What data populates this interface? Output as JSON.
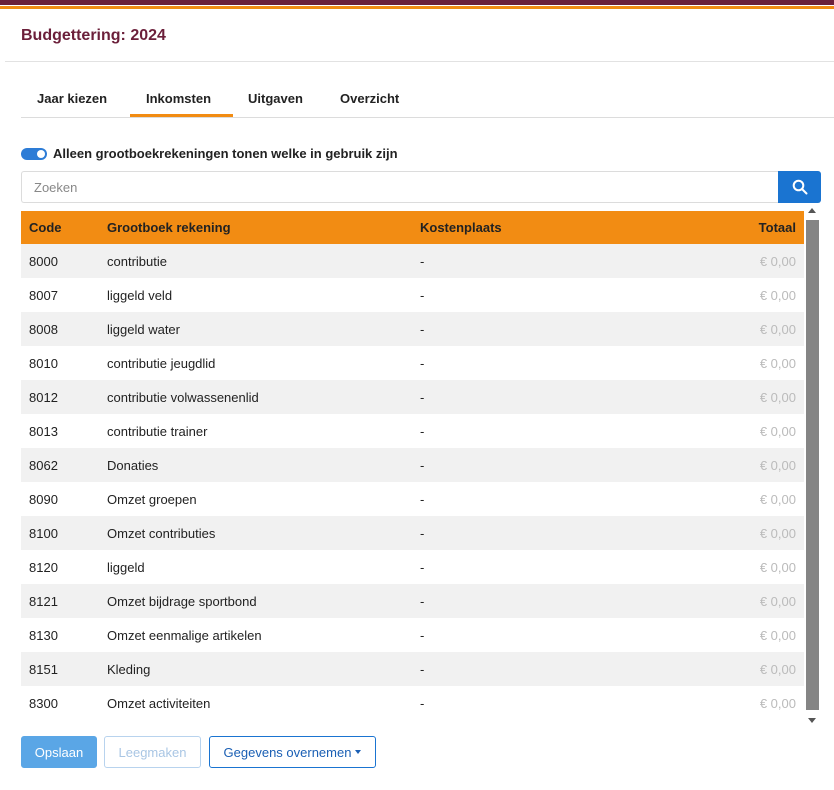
{
  "colors": {
    "brand_dark": "#6b1f3a",
    "accent": "#f28c13",
    "primary": "#1a74d1"
  },
  "header": {
    "title": "Budgettering: 2024"
  },
  "tabs": [
    {
      "label": "Jaar kiezen",
      "active": false
    },
    {
      "label": "Inkomsten",
      "active": true
    },
    {
      "label": "Uitgaven",
      "active": false
    },
    {
      "label": "Overzicht",
      "active": false
    }
  ],
  "filter": {
    "toggle_on": true,
    "label": "Alleen grootboekrekeningen tonen welke in gebruik zijn"
  },
  "search": {
    "placeholder": "Zoeken",
    "value": "",
    "icon": "search-icon"
  },
  "table": {
    "headers": {
      "code": "Code",
      "account": "Grootboek rekening",
      "cost_center": "Kostenplaats",
      "total": "Totaal"
    },
    "rows": [
      {
        "code": "8000",
        "account": "contributie",
        "cost_center": "-",
        "total": "€ 0,00"
      },
      {
        "code": "8007",
        "account": "liggeld veld",
        "cost_center": "-",
        "total": "€ 0,00"
      },
      {
        "code": "8008",
        "account": "liggeld water",
        "cost_center": "-",
        "total": "€ 0,00"
      },
      {
        "code": "8010",
        "account": "contributie jeugdlid",
        "cost_center": "-",
        "total": "€ 0,00"
      },
      {
        "code": "8012",
        "account": "contributie volwassenenlid",
        "cost_center": "-",
        "total": "€ 0,00"
      },
      {
        "code": "8013",
        "account": "contributie trainer",
        "cost_center": "-",
        "total": "€ 0,00"
      },
      {
        "code": "8062",
        "account": "Donaties",
        "cost_center": "-",
        "total": "€ 0,00"
      },
      {
        "code": "8090",
        "account": "Omzet groepen",
        "cost_center": "-",
        "total": "€ 0,00"
      },
      {
        "code": "8100",
        "account": "Omzet contributies",
        "cost_center": "-",
        "total": "€ 0,00"
      },
      {
        "code": "8120",
        "account": "liggeld",
        "cost_center": "-",
        "total": "€ 0,00"
      },
      {
        "code": "8121",
        "account": "Omzet bijdrage sportbond",
        "cost_center": "-",
        "total": "€ 0,00"
      },
      {
        "code": "8130",
        "account": "Omzet eenmalige artikelen",
        "cost_center": "-",
        "total": "€ 0,00"
      },
      {
        "code": "8151",
        "account": "Kleding",
        "cost_center": "-",
        "total": "€ 0,00"
      },
      {
        "code": "8300",
        "account": "Omzet activiteiten",
        "cost_center": "-",
        "total": "€ 0,00"
      }
    ]
  },
  "buttons": {
    "save": "Opslaan",
    "clear": "Leegmaken",
    "copy": "Gegevens overnemen"
  }
}
